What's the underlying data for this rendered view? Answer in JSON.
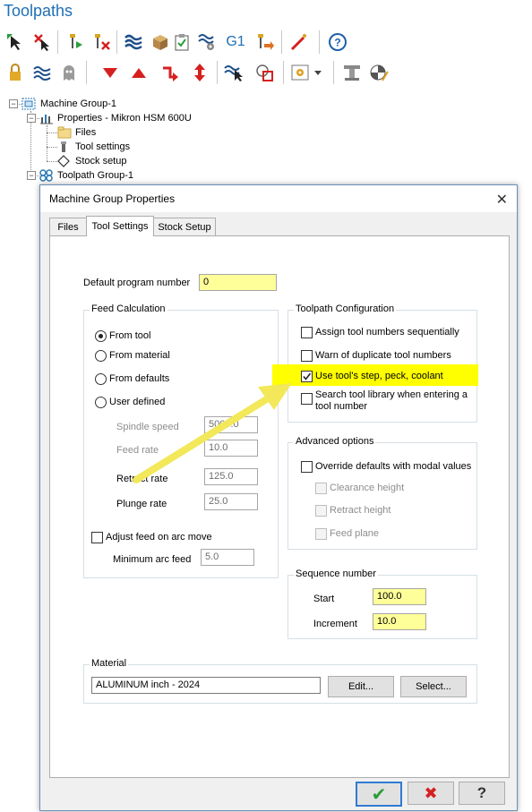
{
  "panel": {
    "title": "Toolpaths"
  },
  "toolbar": {
    "row1": [
      "select-toolpath-icon",
      "deselect-toolpath-icon",
      "regenerate-selected-icon",
      "regenerate-dirty-icon",
      "backplot-icon",
      "verify-icon",
      "simulate-icon",
      "g1-post-icon",
      "post-selected-icon",
      "highfeed-icon",
      "help-icon"
    ],
    "row1_g1_label": "G1",
    "row2": [
      "lock-icon",
      "toggle-display-icon",
      "ghost-icon",
      "move-down-icon",
      "move-up-icon",
      "insert-arrow-icon",
      "scroll-icon",
      "only-display-icon",
      "display-selected-icon",
      "settings-icon",
      "dropdown-icon",
      "tool-manager-icon",
      "safety-zone-icon"
    ]
  },
  "tree": {
    "machine_group": "Machine Group-1",
    "properties": "Properties - Mikron HSM 600U",
    "files": "Files",
    "tool_settings": "Tool settings",
    "stock_setup": "Stock setup",
    "toolpath_group": "Toolpath Group-1"
  },
  "dialog": {
    "title": "Machine Group Properties",
    "close_glyph": "✕",
    "tabs": [
      "Files",
      "Tool Settings",
      "Stock Setup"
    ],
    "default_program_label": "Default program number",
    "default_program_value": "0",
    "feed_calc": {
      "legend": "Feed Calculation",
      "options": [
        "From tool",
        "From material",
        "From defaults",
        "User defined"
      ],
      "selected": "From tool",
      "spindle_speed_label": "Spindle speed",
      "spindle_speed_value": "5000.0",
      "feed_rate_label": "Feed rate",
      "feed_rate_value": "10.0",
      "retract_rate_label": "Retract rate",
      "retract_rate_value": "125.0",
      "plunge_rate_label": "Plunge rate",
      "plunge_rate_value": "25.0",
      "adjust_arc_label": "Adjust feed on arc move",
      "min_arc_label": "Minimum arc feed",
      "min_arc_value": "5.0"
    },
    "toolpath_config": {
      "legend": "Toolpath Configuration",
      "assign_label": "Assign tool numbers sequentially",
      "warn_label": "Warn of duplicate tool numbers",
      "use_label": "Use tool's step, peck, coolant",
      "search_label_1": "Search tool library when entering a",
      "search_label_2": "tool number"
    },
    "advanced": {
      "legend": "Advanced options",
      "override_label": "Override defaults with modal values",
      "clearance_label": "Clearance height",
      "retract_label": "Retract height",
      "feed_plane_label": "Feed plane"
    },
    "sequence": {
      "legend": "Sequence number",
      "start_label": "Start",
      "start_value": "100.0",
      "increment_label": "Increment",
      "increment_value": "10.0"
    },
    "material": {
      "legend": "Material",
      "value": "ALUMINUM inch - 2024",
      "edit_label": "Edit...",
      "select_label": "Select..."
    },
    "footer": {
      "ok_glyph": "✔",
      "cancel_glyph": "✖",
      "help_glyph": "?"
    }
  },
  "colors": {
    "title_blue": "#1f6fb5",
    "highlight_yellow": "#ffff00",
    "field_yellow": "#ffff99",
    "arrow_yellow": "#f2e85a"
  }
}
